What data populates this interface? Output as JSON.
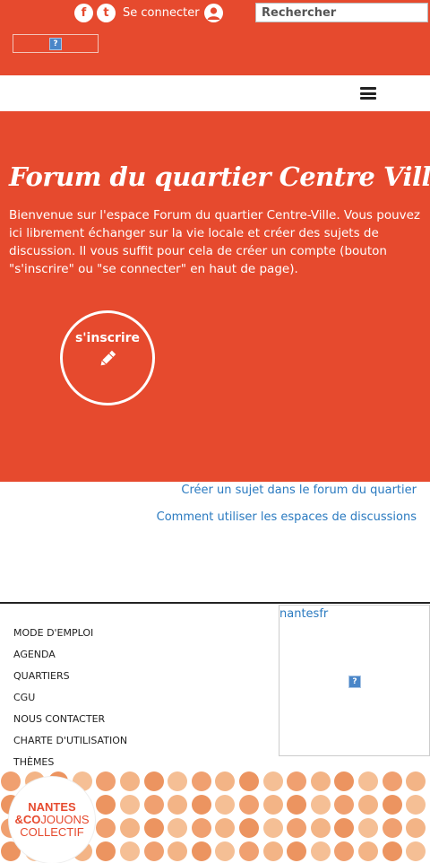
{
  "header": {
    "social": {
      "facebook_letter": "f",
      "twitter_letter": "t"
    },
    "login_label": "Se connecter",
    "search_placeholder": "Rechercher",
    "colors": {
      "brand": "#e64a2e",
      "link": "#2a7ac0"
    }
  },
  "hero": {
    "title": "Forum du quartier Centre Ville",
    "intro": "Bienvenue sur l'espace Forum du quartier Centre-Ville. Vous pouvez ici librement échanger sur la vie locale et créer des sujets de discussion. Il vous suffit pour cela de créer un compte (bouton \"s'inscrire\" ou \"se connecter\" en haut de page).",
    "signup_label": "s'inscrire"
  },
  "links": [
    "Créer un sujet dans le forum du quartier",
    "Comment utiliser les espaces de discussions"
  ],
  "footer": {
    "menu": [
      "MODE D'EMPLOI",
      "AGENDA",
      "QUARTIERS",
      "CGU",
      "NOUS CONTACTER",
      "CHARTE D'UTILISATION",
      "THÈMES"
    ],
    "twitter_handle": "nantesfr",
    "brand": {
      "line1": "NANTES",
      "line2_amp": "&CO",
      "line2_rest": "JOUONS",
      "line3": "COLLECTIF"
    }
  }
}
